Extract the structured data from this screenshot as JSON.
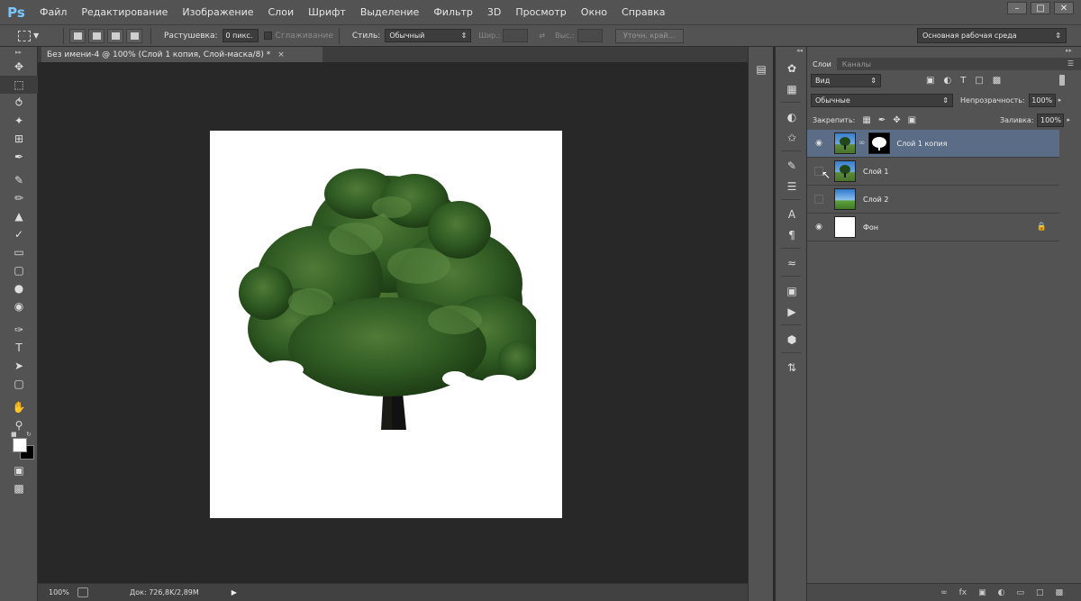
{
  "app": {
    "logo": "Ps",
    "menu": [
      "Файл",
      "Редактирование",
      "Изображение",
      "Слои",
      "Шрифт",
      "Выделение",
      "Фильтр",
      "3D",
      "Просмотр",
      "Окно",
      "Справка"
    ]
  },
  "options": {
    "feather_label": "Растушевка:",
    "feather_value": "0 пикс.",
    "antialias_label": "Сглаживание",
    "style_label": "Стиль:",
    "style_value": "Обычный",
    "width_label": "Шир.:",
    "height_label": "Выс.:",
    "refine_label": "Уточн. край...",
    "workspace": "Основная рабочая среда"
  },
  "document": {
    "tab_title": "Без имени-4 @ 100% (Слой 1 копия, Слой-маска/8) *",
    "zoom": "100%",
    "doc_size": "Док: 726,8K/2,89M"
  },
  "layers_panel": {
    "tabs": [
      "Слои",
      "Каналы"
    ],
    "kind_filter": "Вид",
    "blend_mode": "Обычные",
    "opacity_label": "Непрозрачность:",
    "opacity": "100%",
    "lock_label": "Закрепить:",
    "fill_label": "Заливка:",
    "fill": "100%",
    "layers": [
      {
        "name": "Слой 1 копия",
        "visible": true,
        "selected": true,
        "has_mask": true
      },
      {
        "name": "Слой 1",
        "visible": false,
        "selected": false
      },
      {
        "name": "Слой 2",
        "visible": false,
        "selected": false
      },
      {
        "name": "Фон",
        "visible": true,
        "selected": false,
        "locked": true
      }
    ]
  },
  "colors": {
    "foreground": "#ffffff",
    "background": "#000000",
    "selected_layer": "#5b6c86",
    "ps_logo": "#7cc6ff"
  }
}
